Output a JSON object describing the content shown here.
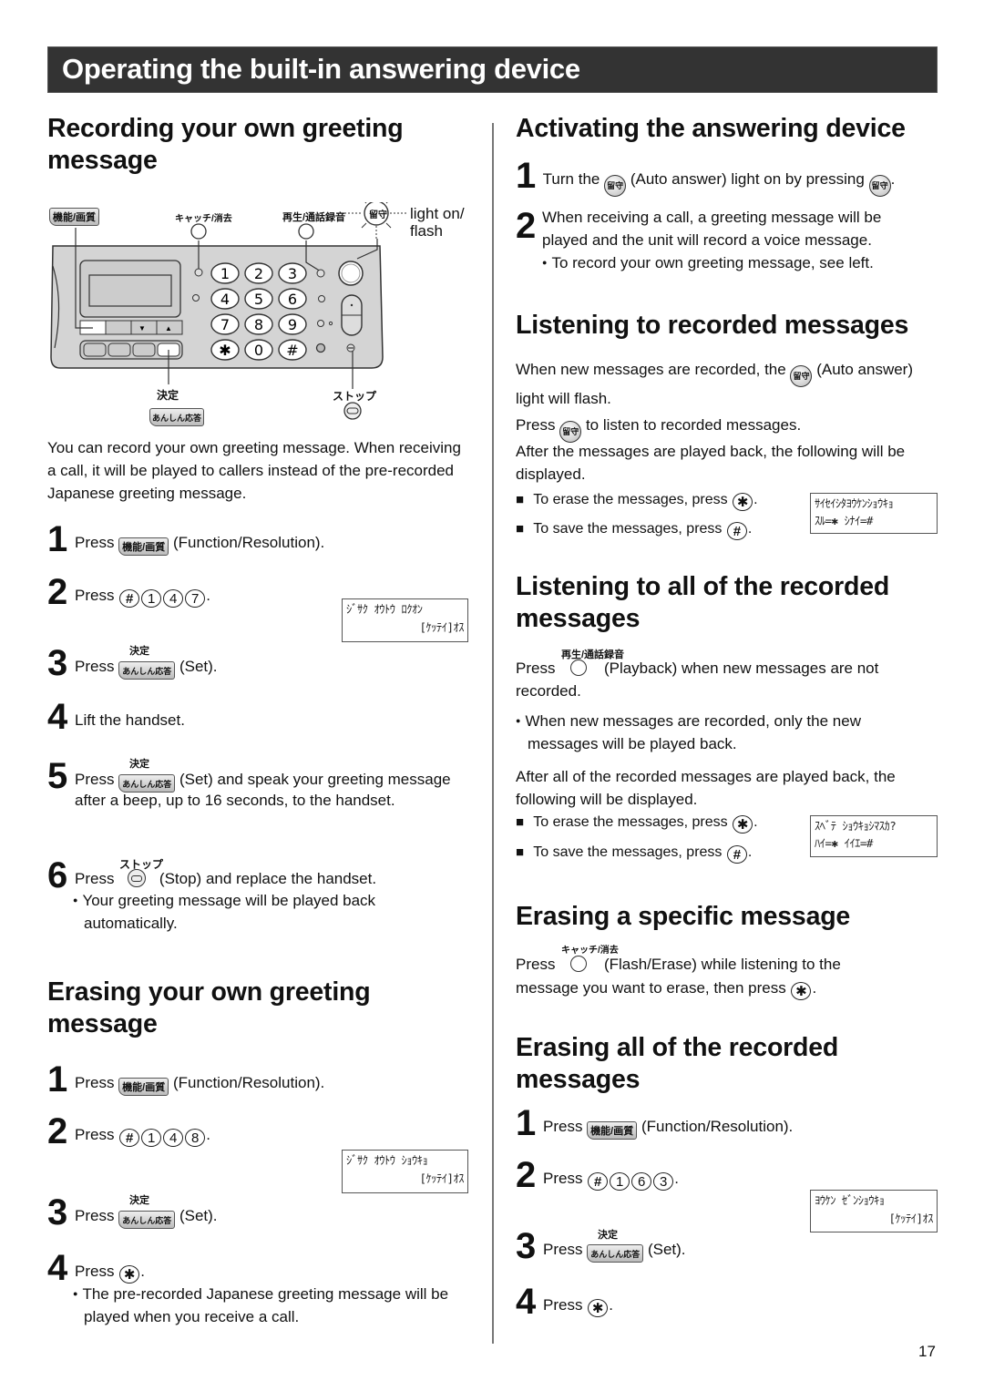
{
  "page": {
    "title": "Operating the built-in answering device",
    "page_number": "17"
  },
  "keys": {
    "function": "機能/画質",
    "set_label": "決定",
    "set_key": "あんしん応答",
    "stop_label": "ストップ",
    "auto_answer": "留守",
    "flash_erase_label": "キャッチ/消去",
    "playback_label": "再生/通話録音",
    "star": "✱",
    "hash": "#"
  },
  "left": {
    "recording": {
      "heading": "Recording your own greeting message",
      "diagram": {
        "function_label": "機能/画質",
        "flash_label": "キャッチ/消去",
        "playback_label": "再生/通話録音",
        "auto_label": "留守",
        "light_note": "light on/ flash",
        "set_label": "決定",
        "set_key": "あんしん応答",
        "stop_label": "ストップ",
        "keypad": [
          "1",
          "2",
          "3",
          "4",
          "5",
          "6",
          "7",
          "8",
          "9",
          "✱",
          "0",
          "#"
        ]
      },
      "intro": "You can record your own greeting message. When receiving a call, it will be played to callers instead of the pre-recorded Japanese greeting message.",
      "steps": [
        {
          "num": "1",
          "pre": "Press",
          "post": "(Function/Resolution)."
        },
        {
          "num": "2",
          "pre": "Press",
          "keys": [
            "#",
            "1",
            "4",
            "7"
          ],
          "post": "."
        },
        {
          "num": "3",
          "pre": "Press",
          "post": "(Set)."
        },
        {
          "num": "4",
          "text": "Lift the handset."
        },
        {
          "num": "5",
          "pre": "Press",
          "post": "(Set) and speak your greeting message",
          "cont": "after a beep, up to 16 seconds, to the handset."
        },
        {
          "num": "6",
          "pre": "Press",
          "post": "(Stop) and replace the handset.",
          "bullet": "Your greeting message will be played back automatically."
        }
      ],
      "lcd": {
        "line1": "ｼﾞｻｸ ｵｳﾄｳ ﾛｸｵﾝ",
        "line2": "[ｹｯﾃｲ]ｵｽ"
      }
    },
    "erasing_greeting": {
      "heading": "Erasing your own greeting message",
      "steps": [
        {
          "num": "1",
          "pre": "Press",
          "post": "(Function/Resolution)."
        },
        {
          "num": "2",
          "pre": "Press",
          "keys": [
            "#",
            "1",
            "4",
            "8"
          ],
          "post": "."
        },
        {
          "num": "3",
          "pre": "Press",
          "post": "(Set)."
        },
        {
          "num": "4",
          "pre": "Press",
          "post": ".",
          "bullet": "The pre-recorded Japanese greeting message will be played when you receive a call."
        }
      ],
      "lcd": {
        "line1": "ｼﾞｻｸ ｵｳﾄｳ ｼｮｳｷｮ",
        "line2": "[ｹｯﾃｲ]ｵｽ"
      }
    }
  },
  "right": {
    "activating": {
      "heading": "Activating the answering device",
      "step1": {
        "num": "1",
        "pre": "Turn the",
        "mid": "(Auto answer) light on by pressing",
        "post": "."
      },
      "step2": {
        "num": "2",
        "text": "When receiving a call, a greeting message will be played and the unit will record a voice message.",
        "bullet": "To record your own greeting message, see left."
      }
    },
    "listening": {
      "heading": "Listening to recorded messages",
      "p1_pre": "When new messages are recorded, the",
      "p1_post": "(Auto answer) light will flash.",
      "p2_pre": "Press",
      "p2_post": "to listen to recorded messages.",
      "p3": "After the messages are played back, the following will be displayed.",
      "erase": "To erase the messages, press",
      "save": "To save the messages, press",
      "lcd": {
        "line1": "ｻｲｾｲｼﾀﾖｳｹﾝｼｮｳｷｮ",
        "line2": "ｽﾙ=✱ ｼﾅｲ=#"
      }
    },
    "listening_all": {
      "heading": "Listening to all of the recorded messages",
      "p1_pre": "Press",
      "p1_post": "(Playback) when new messages are not recorded.",
      "bullet": "When new messages are recorded, only the new messages will be played back.",
      "p2": "After all of the recorded messages are played back, the following will be displayed.",
      "erase": "To erase the messages, press",
      "save": "To save the messages, press",
      "lcd": {
        "line1": "ｽﾍﾞﾃ ｼｮｳｷｮｼﾏｽｶ?",
        "line2": "ﾊｲ=✱ ｲｲｴ=#"
      }
    },
    "erasing_specific": {
      "heading": "Erasing a specific message",
      "p1_pre": "Press",
      "p1_post": "(Flash/Erase) while listening to the",
      "p2": "message you want to erase, then press"
    },
    "erasing_all": {
      "heading": "Erasing all of the recorded messages",
      "steps": [
        {
          "num": "1",
          "pre": "Press",
          "post": "(Function/Resolution)."
        },
        {
          "num": "2",
          "pre": "Press",
          "keys": [
            "#",
            "1",
            "6",
            "3"
          ],
          "post": "."
        },
        {
          "num": "3",
          "pre": "Press",
          "post": "(Set)."
        },
        {
          "num": "4",
          "pre": "Press",
          "post": "."
        }
      ],
      "lcd": {
        "line1": "ﾖｳｹﾝ ｾﾞﾝｼｮｳｷｮ",
        "line2": "[ｹｯﾃｲ]ｵｽ"
      }
    }
  },
  "colors": {
    "header_bg": "#333333",
    "header_text": "#ffffff",
    "device_body": "#d4d4d4"
  }
}
